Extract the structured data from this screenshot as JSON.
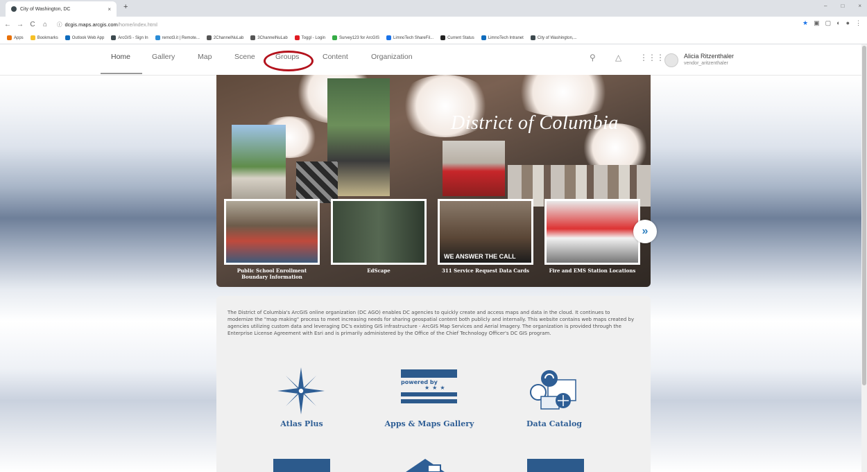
{
  "browser": {
    "tab_title": "City of Washington, DC",
    "tab_close": "×",
    "new_tab": "+",
    "window_controls": [
      "–",
      "□",
      "×"
    ],
    "url_host": "dcgis.maps.arcgis.com",
    "url_path": "/home/index.html",
    "nav": [
      "←",
      "→",
      "C",
      "⌂"
    ],
    "bookmarks": [
      {
        "label": "Apps",
        "color": "#e8710a"
      },
      {
        "label": "Bookmarks",
        "color": "#f6c026"
      },
      {
        "label": "Outlook Web App",
        "color": "#0f6cbd"
      },
      {
        "label": "ArcGIS - Sign In",
        "color": "#3d4a4f"
      },
      {
        "label": "remot3.it | Remote...",
        "color": "#2b8cd6"
      },
      {
        "label": "2ChannelNuLab",
        "color": "#555555"
      },
      {
        "label": "3ChannelNuLab",
        "color": "#555555"
      },
      {
        "label": "Toggl - Login",
        "color": "#e01b22"
      },
      {
        "label": "Survey123 for ArcGIS",
        "color": "#35ac46"
      },
      {
        "label": "LimnoTech ShareFil...",
        "color": "#1a73e8"
      },
      {
        "label": "Current Status",
        "color": "#222222"
      },
      {
        "label": "LimnoTech Intranet",
        "color": "#0f6cbd"
      },
      {
        "label": "City of Washington,...",
        "color": "#3d4a4f"
      }
    ]
  },
  "header": {
    "nav": [
      "Home",
      "Gallery",
      "Map",
      "Scene",
      "Groups",
      "Content",
      "Organization"
    ],
    "user_name": "Alicia Ritzenthaler",
    "user_handle": "vendor_aritzenthaler"
  },
  "banner": {
    "title": "District of Columbia",
    "cards": [
      "Public School Enrollment Boundary Information",
      "EdScape",
      "311 Service Request Data Cards",
      "Fire and EMS Station Locations"
    ],
    "card3_overlay": "WE ANSWER THE CALL",
    "next": "»"
  },
  "info": {
    "text": "The District of Columbia's ArcGIS online organization (DC AGO) enables DC agencies to quickly create and access maps and data in the cloud. It continues to modernize the \"map making\" process to meet increasing needs for sharing geospatial content both publicly and internally. This website contains web maps created by agencies utilizing custom data and leveraging DC's existing GIS infrastructure - ArcGIS Map Services and Aerial Imagery. The organization is provided through the Enterprise License Agreement with Esri and is primarily administered by the Office of the Chief Technology Officer's DC GIS program.",
    "tiles": [
      "Atlas Plus",
      "Apps & Maps Gallery",
      "Data Catalog"
    ],
    "powered_by": "powered by"
  },
  "colors": {
    "accent_blue": "#2e5e95",
    "highlight_red": "#b3121c"
  }
}
